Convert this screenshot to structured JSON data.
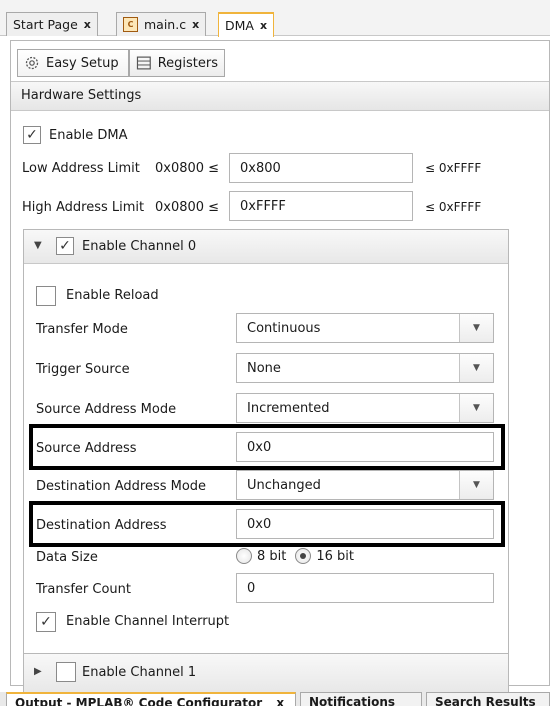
{
  "doc_tabs": [
    {
      "label": "Start Page",
      "close": "x"
    },
    {
      "label": "main.c",
      "close": "x",
      "icon": "c-file-icon"
    },
    {
      "label": "DMA",
      "close": "x",
      "active": true
    }
  ],
  "mode_buttons": {
    "easy_setup": "Easy Setup",
    "registers": "Registers"
  },
  "hardware_settings": {
    "title": "Hardware Settings",
    "enable_dma": {
      "label": "Enable DMA",
      "checked": true
    },
    "low_limit": {
      "label": "Low Address Limit",
      "prefix": "0x0800 ≤",
      "value": "0x800",
      "suffix": "≤ 0xFFFF"
    },
    "high_limit": {
      "label": "High Address Limit",
      "prefix": "0x0800 ≤",
      "value": "0xFFFF",
      "suffix": "≤ 0xFFFF"
    }
  },
  "channel0": {
    "header": "Enable Channel  0",
    "expanded": true,
    "checked": true,
    "enable_reload": {
      "label": "Enable Reload",
      "checked": false
    },
    "transfer_mode": {
      "label": "Transfer Mode",
      "value": "Continuous"
    },
    "trigger_source": {
      "label": "Trigger Source",
      "value": "None"
    },
    "source_address_mode": {
      "label": "Source Address Mode",
      "value": "Incremented"
    },
    "source_address": {
      "label": "Source Address",
      "value": "0x0"
    },
    "destination_address_mode": {
      "label": "Destination Address Mode",
      "value": "Unchanged"
    },
    "destination_address": {
      "label": "Destination Address",
      "value": "0x0"
    },
    "data_size": {
      "label": "Data Size",
      "option_8": "8 bit",
      "option_16": "16 bit",
      "selected": "16 bit"
    },
    "transfer_count": {
      "label": "Transfer Count",
      "value": "0"
    },
    "enable_interrupt": {
      "label": "Enable Channel Interrupt",
      "checked": true
    }
  },
  "channel1": {
    "header": "Enable Channel  1",
    "expanded": false,
    "checked": false
  },
  "output_tabs": [
    {
      "label": "Output - MPLAB® Code Configurator",
      "close": "x"
    },
    {
      "label": "Notifications"
    },
    {
      "label": "Search Results"
    }
  ]
}
